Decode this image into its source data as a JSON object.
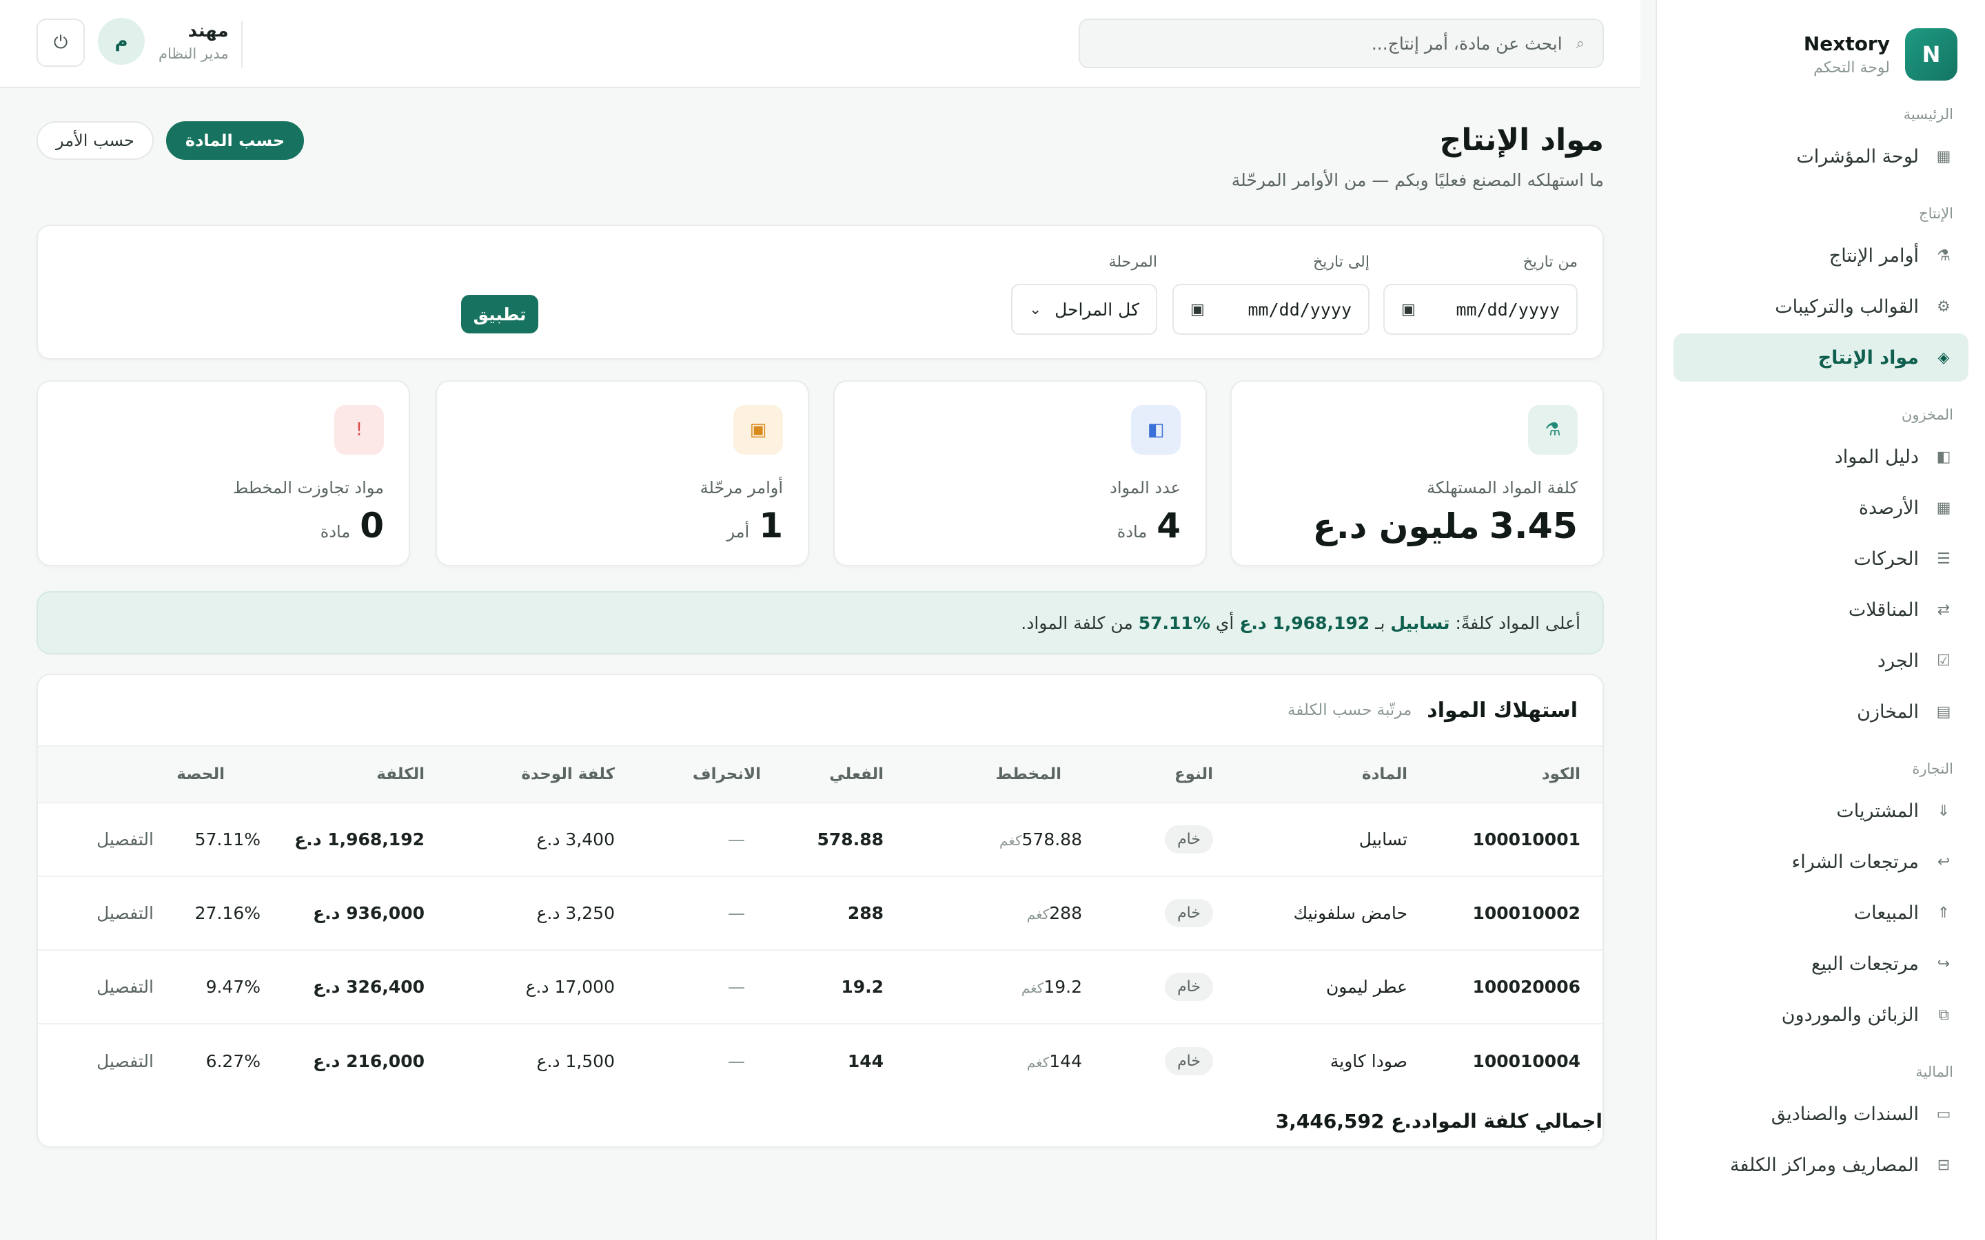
{
  "brand": {
    "name": "Nextory",
    "subtitle": "لوحة التحكم",
    "logo_letter": "N"
  },
  "sidebar": {
    "groups": [
      {
        "title": "الرئيسية",
        "items": [
          {
            "label": "لوحة المؤشرات",
            "icon": "grid-icon"
          }
        ]
      },
      {
        "title": "الإنتاج",
        "items": [
          {
            "label": "أوامر الإنتاج",
            "icon": "factory-icon"
          },
          {
            "label": "القوالب والتركيبات",
            "icon": "gear-icon"
          },
          {
            "label": "مواد الإنتاج",
            "icon": "diamond-icon",
            "active": true
          }
        ]
      },
      {
        "title": "المخزون",
        "items": [
          {
            "label": "دليل المواد",
            "icon": "book-icon"
          },
          {
            "label": "الأرصدة",
            "icon": "grid-icon"
          },
          {
            "label": "الحركات",
            "icon": "sliders-icon"
          },
          {
            "label": "المناقلات",
            "icon": "swap-icon"
          },
          {
            "label": "الجرد",
            "icon": "checkbox-icon"
          },
          {
            "label": "المخازن",
            "icon": "warehouse-icon"
          }
        ]
      },
      {
        "title": "التجارة",
        "items": [
          {
            "label": "المشتريات",
            "icon": "arrow-down-icon"
          },
          {
            "label": "مرتجعات الشراء",
            "icon": "return-icon"
          },
          {
            "label": "المبيعات",
            "icon": "arrow-up-icon"
          },
          {
            "label": "مرتجعات البيع",
            "icon": "forward-icon"
          },
          {
            "label": "الزبائن والموردون",
            "icon": "contacts-icon"
          }
        ]
      },
      {
        "title": "المالية",
        "items": [
          {
            "label": "السندات والصناديق",
            "icon": "cash-icon"
          },
          {
            "label": "المصاريف ومراكز الكلفة",
            "icon": "ledger-icon"
          }
        ]
      }
    ]
  },
  "topbar": {
    "search_placeholder": "ابحث عن مادة، أمر إنتاج...",
    "user_name": "مهند",
    "user_role": "مدير النظام",
    "avatar_letter": "م"
  },
  "page": {
    "title": "مواد الإنتاج",
    "subtitle": "ما استهلكه المصنع فعليًا وبكم — من الأوامر المرحّلة",
    "view_toggle": {
      "by_material": "حسب المادة",
      "by_order": "حسب الأمر",
      "active": "by_material"
    }
  },
  "filters": {
    "from_label": "من تاريخ",
    "from_value": "mm/dd/yyyy",
    "to_label": "إلى تاريخ",
    "to_value": "mm/dd/yyyy",
    "stage_label": "المرحلة",
    "stage_value": "كل المراحل",
    "apply_label": "تطبيق"
  },
  "kpis": [
    {
      "label": "كلفة المواد المستهلكة",
      "value": "3.45",
      "unit": "مليون د.ع",
      "icon": "factory-icon",
      "color": "#1f8a73",
      "bg": "#e6f2ee"
    },
    {
      "label": "عدد المواد",
      "value": "4",
      "unit": "مادة",
      "icon": "book-icon",
      "color": "#3a6fd8",
      "bg": "#e7eefb"
    },
    {
      "label": "أوامر مرحّلة",
      "value": "1",
      "unit": "أمر",
      "icon": "box-icon",
      "color": "#d98a1c",
      "bg": "#fdf1e0"
    },
    {
      "label": "مواد تجاوزت المخطط",
      "value": "0",
      "unit": "مادة",
      "icon": "alert-icon",
      "color": "#d94a4a",
      "bg": "#fde8e8"
    }
  ],
  "insight": {
    "prefix": "أعلى المواد كلفةً:",
    "material": "تسابيل",
    "by": "بـ",
    "amount": "1,968,192 د.ع",
    "share_prefix": "أي",
    "share": "57.11%",
    "suffix": "من كلفة المواد."
  },
  "table": {
    "title": "استهلاك المواد",
    "subtitle": "مرتّبة حسب الكلفة",
    "columns": [
      "الكود",
      "المادة",
      "النوع",
      "المخطط",
      "الفعلي",
      "الانحراف",
      "كلفة الوحدة",
      "الكلفة",
      "الحصة"
    ],
    "rows": [
      {
        "code": "100010001",
        "material": "تسابيل",
        "type": "خام",
        "plan": "578.88",
        "plan_unit": "كغم",
        "actual": "578.88",
        "deviation": "—",
        "unit_cost": "3,400 د.ع",
        "cost": "1,968,192 د.ع",
        "share": "57.11%",
        "detail": "التفصيل"
      },
      {
        "code": "100010002",
        "material": "حامض سلفونيك",
        "type": "خام",
        "plan": "288",
        "plan_unit": "كغم",
        "actual": "288",
        "deviation": "—",
        "unit_cost": "3,250 د.ع",
        "cost": "936,000 د.ع",
        "share": "27.16%",
        "detail": "التفصيل"
      },
      {
        "code": "100020006",
        "material": "عطر ليمون",
        "type": "خام",
        "plan": "19.2",
        "plan_unit": "كغم",
        "actual": "19.2",
        "deviation": "—",
        "unit_cost": "17,000 د.ع",
        "cost": "326,400 د.ع",
        "share": "9.47%",
        "detail": "التفصيل"
      },
      {
        "code": "100010004",
        "material": "صودا كاوية",
        "type": "خام",
        "plan": "144",
        "plan_unit": "كغم",
        "actual": "144",
        "deviation": "—",
        "unit_cost": "1,500 د.ع",
        "cost": "216,000 د.ع",
        "share": "6.27%",
        "detail": "التفصيل"
      }
    ],
    "total_label": "اجمالي كلفة المواد",
    "total_value": "د.ع 3,446,592"
  },
  "colors": {
    "accent": "#17735f",
    "accent_light": "#e3f1ed",
    "background": "#f6f8f7"
  }
}
